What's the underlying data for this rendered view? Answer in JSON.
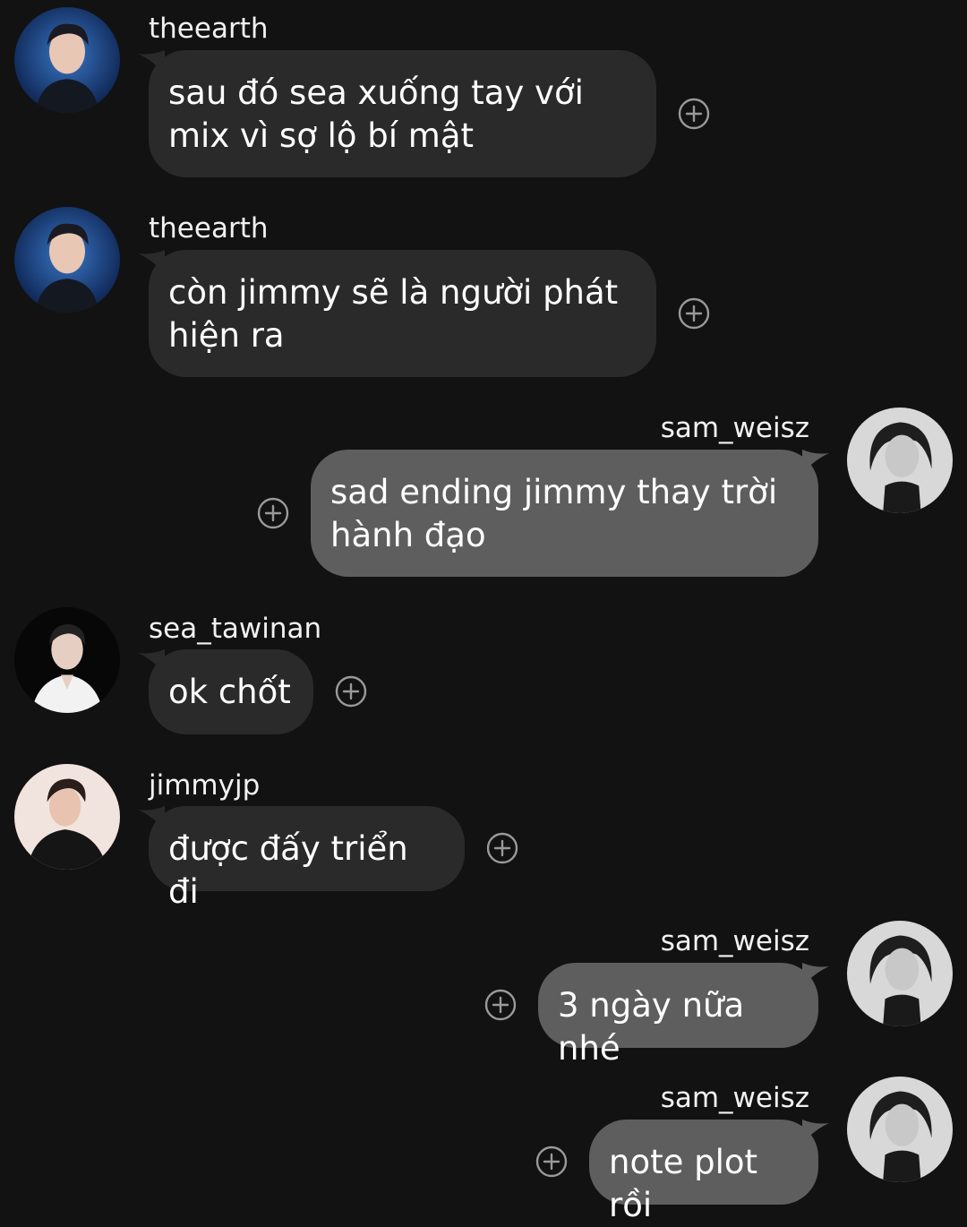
{
  "messages": [
    {
      "username": "theearth",
      "text": "sau đó sea xuống tay với mix vì sợ lộ bí mật",
      "direction": "incoming",
      "avatar": "theearth-avatar"
    },
    {
      "username": "theearth",
      "text": "còn jimmy sẽ là người phát hiện ra",
      "direction": "incoming",
      "avatar": "theearth-avatar"
    },
    {
      "username": "sam_weisz",
      "text": "sad ending jimmy thay trời hành đạo",
      "direction": "outgoing",
      "avatar": "sam-weisz-avatar"
    },
    {
      "username": "sea_tawinan",
      "text": "ok chốt",
      "direction": "incoming",
      "avatar": "sea-tawinan-avatar"
    },
    {
      "username": "jimmyjp",
      "text": "được đấy triển đi",
      "direction": "incoming",
      "avatar": "jimmyjp-avatar"
    },
    {
      "username": "sam_weisz",
      "text": "3 ngày nữa nhé",
      "direction": "outgoing",
      "avatar": "sam-weisz-avatar"
    },
    {
      "username": "sam_weisz",
      "text": "note plot rồi",
      "direction": "outgoing",
      "avatar": "sam-weisz-avatar"
    }
  ],
  "colors": {
    "background": "#121212",
    "incoming_bubble": "#2a2a2a",
    "outgoing_bubble": "#5e5e5e",
    "text": "#ffffff",
    "react_icon": "#9a9a9a"
  },
  "icons": {
    "react": "add-reaction-icon"
  }
}
